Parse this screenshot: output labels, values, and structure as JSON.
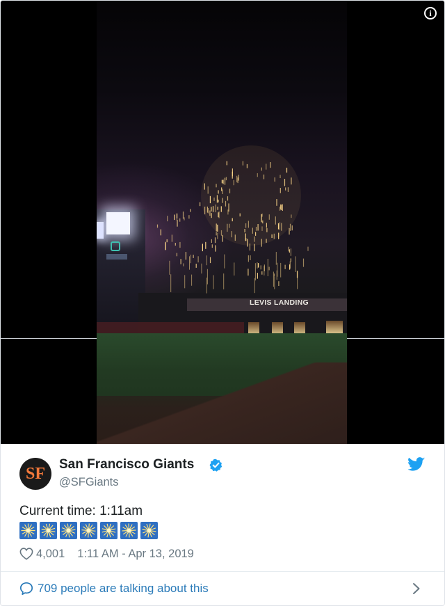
{
  "media": {
    "sign_text": "LEVIS LANDING",
    "info_icon": "info-icon",
    "info_glyph": "i"
  },
  "tweet": {
    "avatar": {
      "glyph": "SF",
      "icon": "sf-giants-logo-icon"
    },
    "author_name": "San Francisco Giants",
    "verified_icon": "verified-badge-icon",
    "handle": "@SFGiants",
    "platform_icon": "twitter-bird-icon",
    "text": "Current time: 1:11am",
    "emoji_count": 7,
    "emoji_icon": "sparkler-emoji-icon",
    "like_icon": "heart-icon",
    "likes": "4,001",
    "timestamp": "1:11 AM - Apr 13, 2019",
    "conversation_icon": "speech-bubble-icon",
    "conversation_text": "709 people are talking about this",
    "chevron_icon": "chevron-right-icon"
  },
  "colors": {
    "link": "#2b7bb9",
    "verified": "#1da1f2",
    "muted": "#697882",
    "text": "#1c2022",
    "emoji_bg": "#2f6fc2",
    "firework": "#ffd98a"
  }
}
